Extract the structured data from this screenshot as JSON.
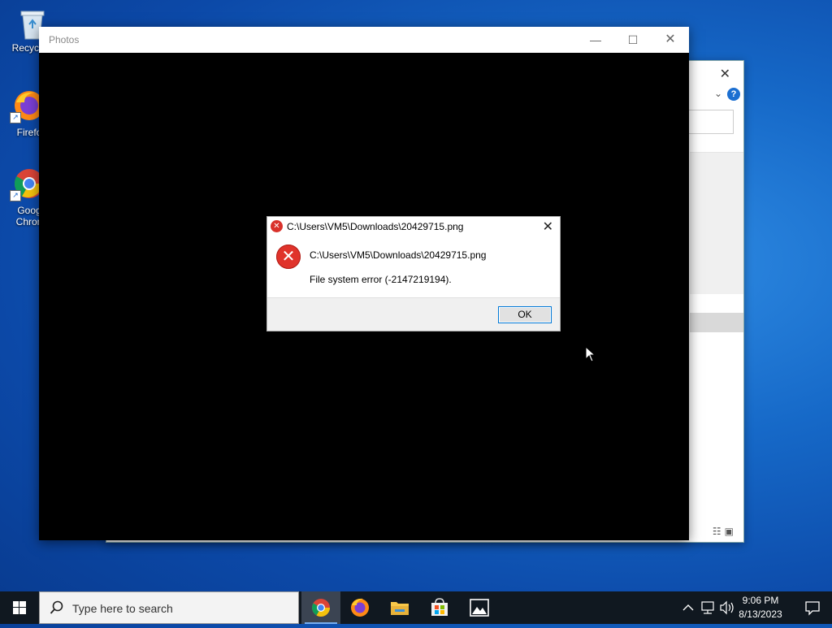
{
  "desktop": {
    "icons": [
      {
        "label": "Recycle",
        "icon": "recycle-bin-icon"
      },
      {
        "label": "Firefo",
        "icon": "firefox-icon"
      },
      {
        "label": "Goog",
        "label2": "Chron",
        "icon": "chrome-icon"
      }
    ]
  },
  "photos_window": {
    "title": "Photos",
    "min_glyph": "—",
    "max_glyph": "☐",
    "close_glyph": "✕"
  },
  "background_window": {
    "close_glyph": "✕",
    "chevron_glyph": "⌄",
    "help_glyph": "?"
  },
  "error_dialog": {
    "title": "C:\\Users\\VM5\\Downloads\\20429715.png",
    "path": "C:\\Users\\VM5\\Downloads\\20429715.png",
    "message": "File system error (-2147219194).",
    "ok_label": "OK",
    "close_glyph": "✕",
    "icon_glyph": "✕"
  },
  "taskbar": {
    "search_placeholder": "Type here to search",
    "apps": [
      "chrome-icon",
      "firefox-icon",
      "file-explorer-icon",
      "microsoft-store-icon",
      "photos-icon"
    ],
    "active_app": "chrome-icon",
    "time": "9:06 PM",
    "date": "8/13/2023",
    "tray_icons": [
      "chevron-up-icon",
      "network-icon",
      "volume-icon"
    ]
  },
  "colors": {
    "accent": "#0078d7",
    "error_red": "#e0332b",
    "taskbar": "#101820"
  }
}
